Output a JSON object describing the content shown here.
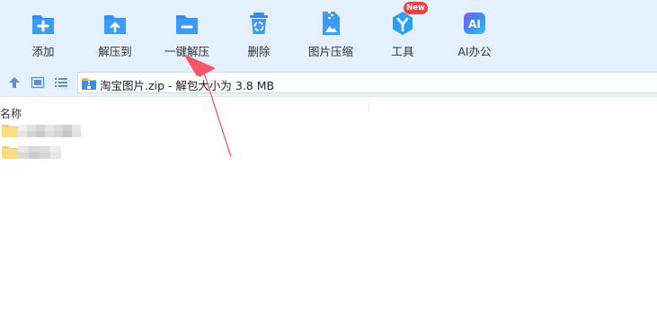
{
  "toolbar": {
    "items": [
      {
        "label": "添加",
        "icon": "add-file-icon"
      },
      {
        "label": "解压到",
        "icon": "extract-to-icon"
      },
      {
        "label": "一键解压",
        "icon": "one-click-extract-icon"
      },
      {
        "label": "删除",
        "icon": "recycle-bin-icon"
      },
      {
        "label": "图片压缩",
        "icon": "image-compress-icon"
      },
      {
        "label": "工具",
        "icon": "tools-icon"
      },
      {
        "label": "AI办公",
        "icon": "ai-office-icon"
      }
    ],
    "new_badge": "New"
  },
  "address": {
    "path_text": "淘宝图片.zip - 解包大小为 3.8 MB",
    "icon": "zip-archive-icon"
  },
  "list": {
    "column_name": "名称",
    "rows": [
      {
        "type": "folder",
        "name_hidden": true
      },
      {
        "type": "folder",
        "name_hidden": true
      }
    ]
  },
  "colors": {
    "toolbar_bg": "#e4f0fd",
    "icon_blue": "#2f8ef0",
    "badge_red": "#f0413f",
    "annotation_arrow": "#f2576a"
  }
}
